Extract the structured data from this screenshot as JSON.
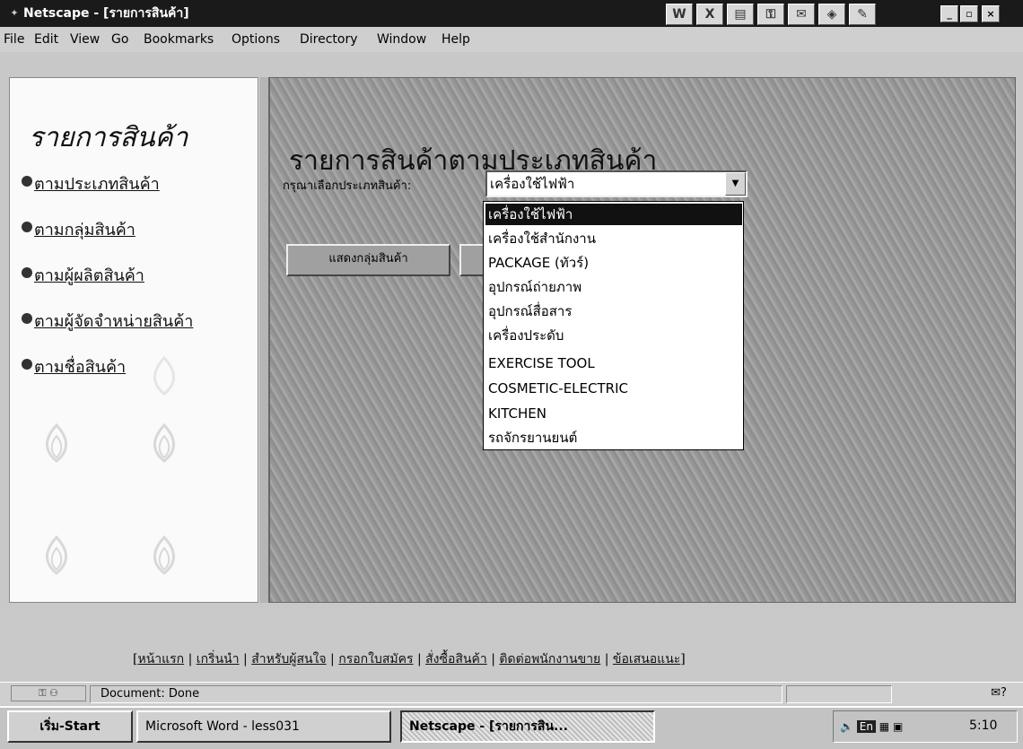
{
  "window": {
    "title": "Netscape - [รายการสินค้า]",
    "quicklaunch_icons": [
      "word-icon",
      "excel-icon",
      "powerpoint-icon",
      "access-icon",
      "outlook-icon",
      "book-icon",
      "tools-icon"
    ],
    "controls": {
      "minimize": "_",
      "maximize": "▫",
      "close": "×"
    }
  },
  "menu": {
    "items": [
      {
        "label": "File"
      },
      {
        "label": "Edit"
      },
      {
        "label": "View"
      },
      {
        "label": "Go"
      },
      {
        "label": "Bookmarks"
      },
      {
        "label": "Options"
      },
      {
        "label": "Directory"
      },
      {
        "label": "Window"
      },
      {
        "label": "Help"
      }
    ]
  },
  "left_frame": {
    "title": "รายการสินค้า",
    "links": [
      {
        "label": "ตามประเภทสินค้า"
      },
      {
        "label": "ตามกลุ่มสินค้า"
      },
      {
        "label": "ตามผู้ผลิตสินค้า"
      },
      {
        "label": "ตามผู้จัดจำหน่ายสินค้า"
      },
      {
        "label": "ตามชื่อสินค้า"
      }
    ]
  },
  "main": {
    "title": "รายการสินค้าตามประเภทสินค้า",
    "select_label": "กรุณาเลือกประเภทสินค้า:",
    "selected_category": "เครื่องใช้ไฟฟ้า",
    "options": [
      "เครื่องใช้ไฟฟ้า",
      "เครื่องใช้สำนักงาน",
      "PACKAGE (ทัวร์)",
      "อุปกรณ์ถ่ายภาพ",
      "อุปกรณ์สื่อสาร",
      "เครื่องประดับ",
      "EXERCISE TOOL",
      "COSMETIC-ELECTRIC",
      "KITCHEN",
      "รถจักรยานยนต์"
    ],
    "show_group_button": "แสดงกลุ่มสินค้า"
  },
  "footer_nav": {
    "links": [
      {
        "label": "หน้าแรก"
      },
      {
        "label": "เกริ่นนำ"
      },
      {
        "label": "สำหรับผู้สนใจ"
      },
      {
        "label": "กรอกใบสมัคร"
      },
      {
        "label": "สั่งซื้อสินค้า"
      },
      {
        "label": "ติดต่อพนักงานขาย"
      },
      {
        "label": "ข้อเสนอแนะ"
      }
    ]
  },
  "status": {
    "text": "Document: Done"
  },
  "taskbar": {
    "start_label": "เริ่ม-Start",
    "tasks": [
      {
        "label": "Microsoft Word - less031"
      },
      {
        "label": "Netscape - [รายการสิน..."
      }
    ],
    "tray_lang": "En",
    "clock": "5:10"
  }
}
